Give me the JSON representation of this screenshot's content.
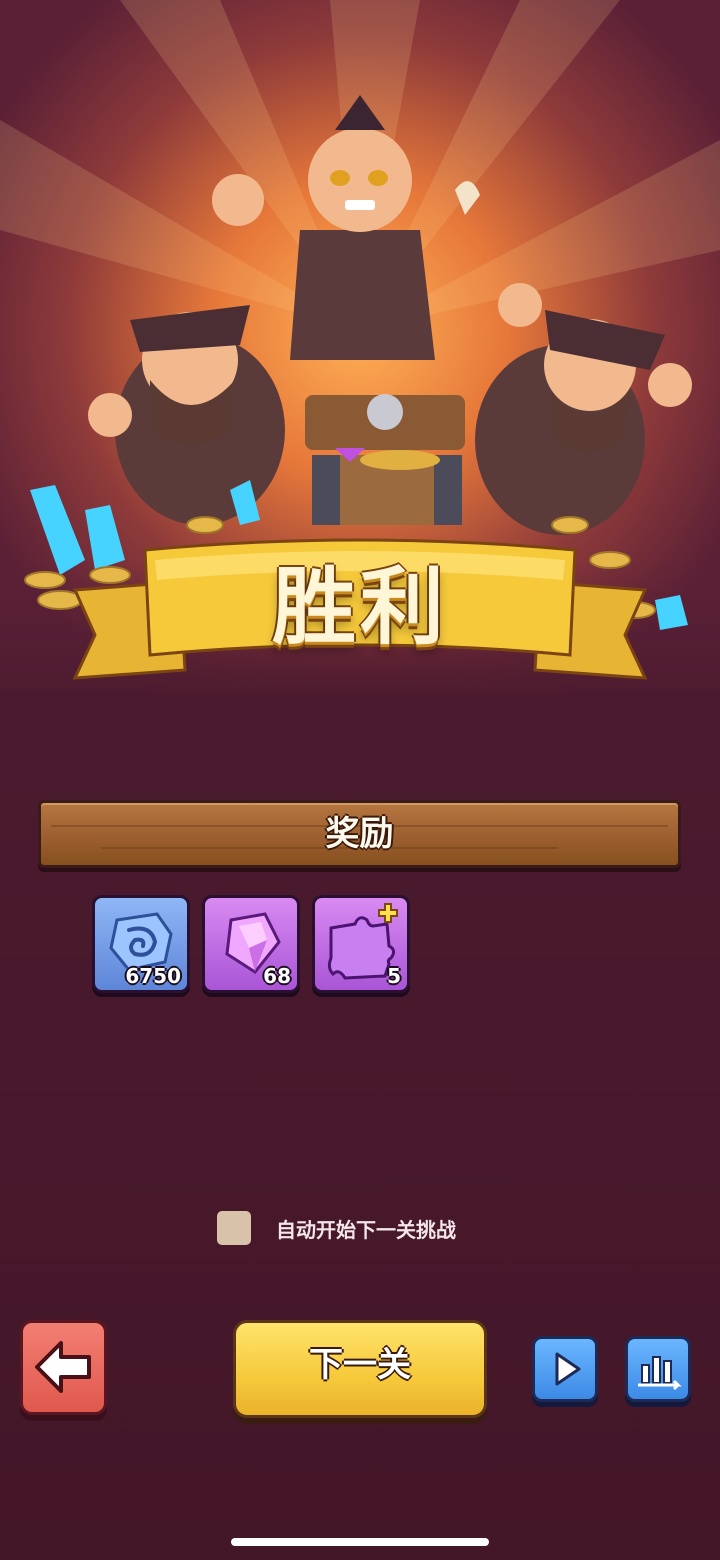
{
  "banner": {
    "title": "胜利"
  },
  "rewards": {
    "title": "奖励",
    "items": [
      {
        "icon": "stone-icon",
        "count": "6750"
      },
      {
        "icon": "purple-gem-icon",
        "count": "68"
      },
      {
        "icon": "puzzle-piece-icon",
        "count": "5"
      }
    ]
  },
  "auto_start": {
    "label": "自动开始下一关挑战",
    "checked": false
  },
  "buttons": {
    "back_icon": "arrow-left-icon",
    "next_label": "下一关",
    "play_icon": "play-icon",
    "stats_icon": "bar-chart-icon"
  },
  "colors": {
    "background": "#4b1a2e",
    "banner_gold": "#f6c93b",
    "wood": "#9c5f30",
    "back_red": "#e0584d",
    "action_blue": "#3d8ae6"
  }
}
